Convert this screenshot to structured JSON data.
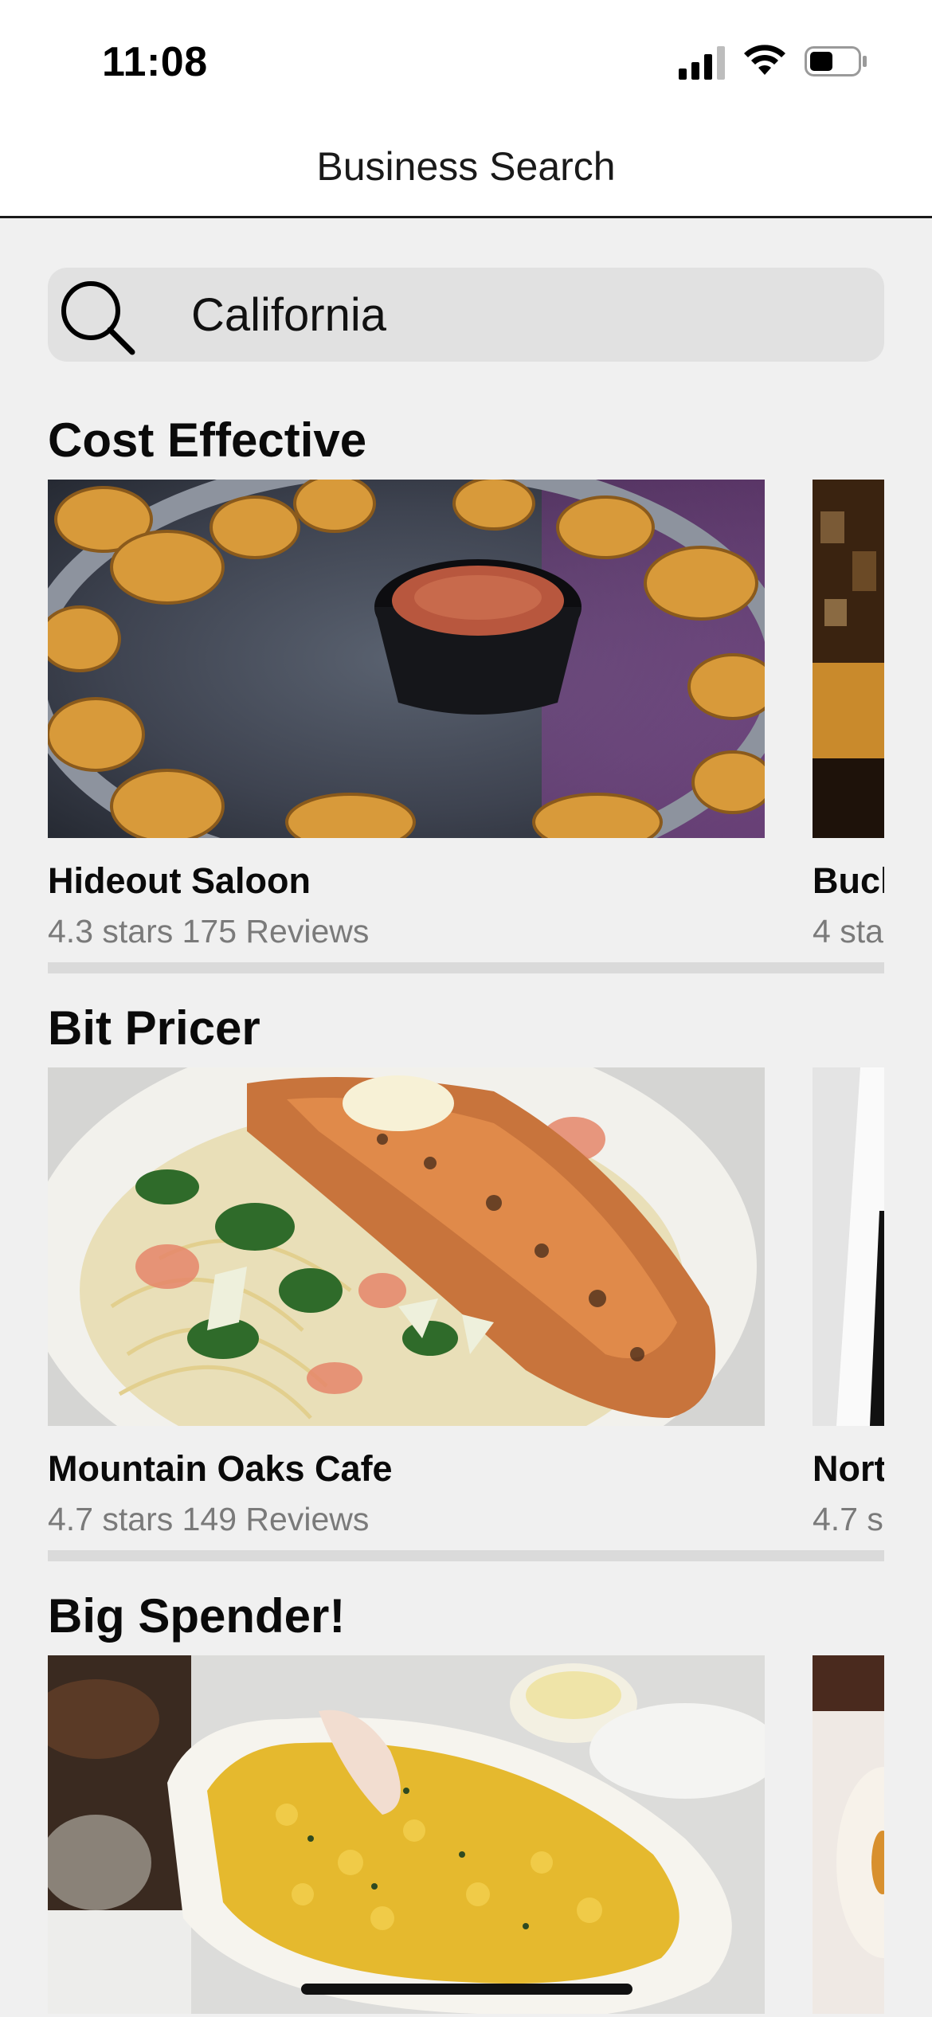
{
  "status_bar": {
    "time": "11:08"
  },
  "nav": {
    "title": "Business Search"
  },
  "search": {
    "value": "California",
    "icon": "search-icon"
  },
  "sections": [
    {
      "title": "Cost Effective",
      "cards": [
        {
          "name": "Hideout Saloon",
          "meta": "4.3 stars 175 Reviews"
        },
        {
          "name": "Buck",
          "meta": "4 sta"
        }
      ]
    },
    {
      "title": "Bit Pricer",
      "cards": [
        {
          "name": "Mountain Oaks Cafe",
          "meta": "4.7 stars 149 Reviews"
        },
        {
          "name": "Nort",
          "meta": "4.7 s"
        }
      ]
    },
    {
      "title": "Big Spender!",
      "cards": []
    }
  ]
}
